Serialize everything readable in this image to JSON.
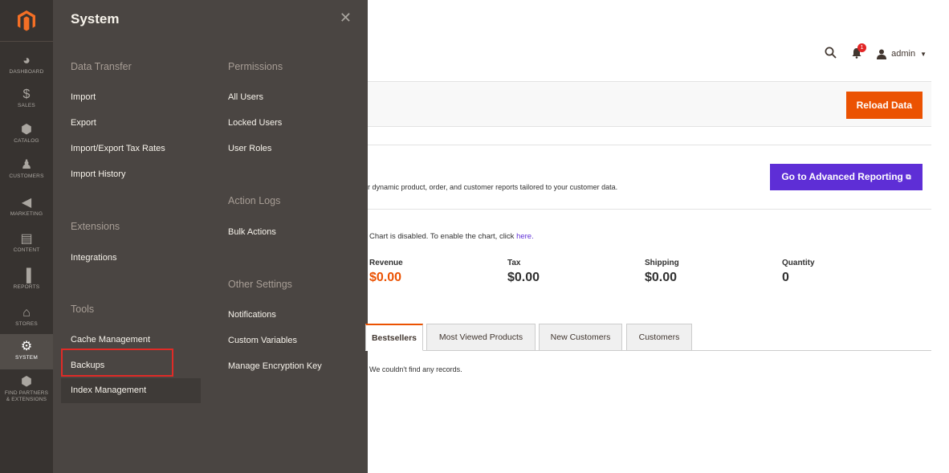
{
  "nav": {
    "items": [
      {
        "label": "DASHBOARD",
        "icon": "dashboard-icon",
        "glyph": "◕"
      },
      {
        "label": "SALES",
        "icon": "dollar-icon",
        "glyph": "$"
      },
      {
        "label": "CATALOG",
        "icon": "cube-icon",
        "glyph": "⬢"
      },
      {
        "label": "CUSTOMERS",
        "icon": "person-icon",
        "glyph": "♟"
      },
      {
        "label": "MARKETING",
        "icon": "megaphone-icon",
        "glyph": "◀"
      },
      {
        "label": "CONTENT",
        "icon": "layout-icon",
        "glyph": "▤"
      },
      {
        "label": "REPORTS",
        "icon": "bar-chart-icon",
        "glyph": "▐"
      },
      {
        "label": "STORES",
        "icon": "store-icon",
        "glyph": "⌂"
      },
      {
        "label": "SYSTEM",
        "icon": "gear-icon",
        "glyph": "⚙"
      },
      {
        "label": "FIND PARTNERS & EXTENSIONS",
        "icon": "box-icon",
        "glyph": "⬢"
      }
    ]
  },
  "flyout": {
    "title": "System",
    "sections": {
      "data_transfer": {
        "title": "Data Transfer",
        "items": [
          "Import",
          "Export",
          "Import/Export Tax Rates",
          "Import History"
        ]
      },
      "extensions": {
        "title": "Extensions",
        "items": [
          "Integrations"
        ]
      },
      "tools": {
        "title": "Tools",
        "items": [
          "Cache Management",
          "Backups",
          "Index Management"
        ]
      },
      "permissions": {
        "title": "Permissions",
        "items": [
          "All Users",
          "Locked Users",
          "User Roles"
        ]
      },
      "action_logs": {
        "title": "Action Logs",
        "items": [
          "Bulk Actions"
        ]
      },
      "other_settings": {
        "title": "Other Settings",
        "items": [
          "Notifications",
          "Custom Variables",
          "Manage Encryption Key"
        ]
      }
    }
  },
  "header": {
    "notifications_count": "1",
    "user": "admin"
  },
  "toolbar": {
    "reload_label": "Reload Data"
  },
  "reporting": {
    "text": "r dynamic product, order, and customer reports tailored to your customer data.",
    "button_label": "Go to Advanced Reporting"
  },
  "chart_note": {
    "text": "Chart is disabled. To enable the chart, click ",
    "link": "here."
  },
  "totals": [
    {
      "label": "Revenue",
      "value": "$0.00"
    },
    {
      "label": "Tax",
      "value": "$0.00"
    },
    {
      "label": "Shipping",
      "value": "$0.00"
    },
    {
      "label": "Quantity",
      "value": "0"
    }
  ],
  "tabs": [
    "Bestsellers",
    "Most Viewed Products",
    "New Customers",
    "Customers"
  ],
  "empty_message": "We couldn't find any records.",
  "colors": {
    "accent": "#eb5202",
    "advanced": "#5e2ed6",
    "nav_bg": "#373330",
    "flyout_bg": "#4a4542",
    "highlight": "#e02b27"
  }
}
